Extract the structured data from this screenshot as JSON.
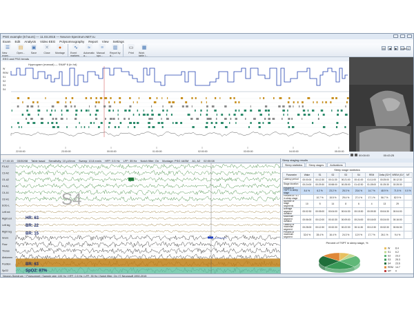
{
  "window": {
    "title": "PSG example (8 hours) — 11.03.2015 — Neuron-Spectrum.NET.ru",
    "menu": [
      "Exam",
      "Edit",
      "Analysis",
      "Video EEG",
      "Polysomnography",
      "Report",
      "View",
      "Settings"
    ]
  },
  "toolbar": {
    "buttons": [
      {
        "label": "New exam...",
        "icon": "new-exam-icon",
        "color": "#3a6fb0"
      },
      {
        "label": "Open...",
        "icon": "open-folder-icon",
        "color": "#e0a43a"
      },
      {
        "label": "Save",
        "icon": "save-icon",
        "color": "#4a78b5"
      },
      {
        "label": "Close",
        "icon": "close-document-icon",
        "color": "#8a9bb0"
      },
      {
        "label": "Montage",
        "icon": "montage-icon",
        "color": "#d66a1f"
      },
      {
        "label": "Event markers",
        "icon": "event-markers-icon",
        "color": "#3a6fb0"
      },
      {
        "label": "Automatic a...",
        "icon": "automatic-analysis-icon",
        "color": "#3a6fb0"
      },
      {
        "label": "Manual spo...",
        "icon": "manual-spo-icon",
        "color": "#7aa0cc"
      },
      {
        "label": "Report by d...",
        "icon": "report-icon",
        "color": "#4a78b5"
      },
      {
        "label": "Print",
        "icon": "print-icon",
        "color": "#555555"
      },
      {
        "label": "Work table i...",
        "icon": "work-table-icon",
        "color": "#3a6fb0"
      }
    ],
    "right_controls": [
      "M",
      "◀",
      "▶",
      "Auto",
      "C"
    ]
  },
  "hypnogram": {
    "header": "EEG and PSG trends",
    "title": "Hypnogram (manual) — SNAP 6 (in hd)",
    "stage_labels": [
      "W",
      "REM",
      "S1",
      "S2",
      "S3",
      "S4"
    ],
    "time_ticks": [
      "22:00:00",
      "23:00:00",
      "00:00:00",
      "01:00:00",
      "02:00:00",
      "03:00:00",
      "04:00:00",
      "05:00:00"
    ]
  },
  "video": {
    "time_start": "00:00:00",
    "time_end": "00:43:25"
  },
  "eeg": {
    "toolbar": [
      "07:40:15",
      "03/30/08",
      "Table basal",
      "Sensitivity: 10 µV/mm",
      "Sweep: 10.8 mm/s",
      "HFF: 0.5 Hz",
      "LFF: 35 Hz",
      "Notch filter: On",
      "Montage: PSG 4ASM",
      "A1, A2",
      "02:00:08"
    ],
    "channels": [
      "F3-A2",
      "C3-A2",
      "O1-A2",
      "F4-A1",
      "C4-A1",
      "O2-A1",
      "EOG-L",
      "Left ext",
      "Right ext",
      "Left leg",
      "Right leg",
      "Snore",
      "Flow",
      "Thorax",
      "Abdomen",
      "Position",
      "SpO2"
    ],
    "stage_overlay": "S4",
    "readouts": {
      "hr": "HR: 63",
      "br1": "BR: 22",
      "br2": "BR: 15",
      "br_bottom": "BR: 63",
      "spo2": "SpO2: 97%"
    },
    "event_label": "Arousal 0.0 s"
  },
  "statusbar": "Neuron-Spectrum + Polysomnet  |  Sample rate: 100 Hz  |  HFF: 0.5 Hz  |  LFF: 35 Hz  |  Notch filter: On  |  © Neurosoft 1992-2015",
  "panel": {
    "title": "Sleep staging results",
    "tabs": [
      "Sleep statistics",
      "Sleep stages",
      "Activations"
    ],
    "active_tab": 1,
    "table_title": "Sleep stage statistics",
    "columns": [
      "Parameter",
      "Wake",
      "S1",
      "S2",
      "S3",
      "S4",
      "REM",
      "Delta (S3+S4)",
      "NREM (S1+S2+S3+S4)",
      "MT"
    ],
    "rows": [
      [
        "Latency period",
        "00:00:00",
        "00:12:30",
        "00:11:30",
        "00:21:00",
        "00:41:00",
        "01:11:00",
        "00:25:00",
        "00:12:30",
        ""
      ],
      [
        "Stage duration",
        "00:24:00",
        "00:29:30",
        "00:58:00",
        "00:28:00",
        "01:42:30",
        "01:28:00",
        "01:25:30",
        "02:28:30",
        ""
      ],
      [
        "Percent of TSPT in sleep stage",
        "8.4 %",
        "6.2 %",
        "23.2 %",
        "25.3 %",
        "23.6 %",
        "14.7 %",
        "48.9 %",
        "71.5 %",
        "0.0 %"
      ],
      [
        "Percent of TST in sleep stage",
        "",
        "10.7 %",
        "15.5 %",
        "29.4 %",
        "27.4 %",
        "17.1 %",
        "56.7 %",
        "82.9 %",
        ""
      ],
      [
        "Number of stage segments",
        "10",
        "5",
        "14",
        "8",
        "6",
        "4",
        "13",
        "29",
        ""
      ],
      [
        "Average segment duration",
        "00:02:30",
        "00:05:00",
        "00:04:00",
        "00:04:30",
        "00:15:30",
        "00:09:30",
        "00:04:30",
        "00:04:00",
        ""
      ],
      [
        "Maximum segment duration",
        "00:06:00",
        "00:12:00",
        "00:10:30",
        "00:09:00",
        "00:24:00",
        "00:16:00",
        "00:24:00",
        "00:16:00",
        ""
      ],
      [
        "Latency of maximum segment",
        "00:28:00",
        "00:12:30",
        "00:32:30",
        "00:22:30",
        "00:11:30",
        "00:12:30",
        "00:32:30",
        "00:06:30",
        ""
      ],
      [
        "Percent of maximum segment",
        "32.6 %",
        "28.4 %",
        "16.4 %",
        "24.3 %",
        "12.9 %",
        "17.7 %",
        "26.1 %",
        "9.4 %",
        ""
      ]
    ],
    "chart_title": "Percent of TSPT in sleep stage, %"
  },
  "chart_data": {
    "type": "pie",
    "title": "Percent of TSPT in sleep stage, %",
    "categories": [
      "W",
      "S1",
      "S2",
      "S3",
      "S4",
      "REM",
      "MT"
    ],
    "values": [
      8.4,
      6.2,
      23.2,
      25.3,
      23.6,
      14.7,
      0.0
    ],
    "colors": [
      "#e8c060",
      "#c0d890",
      "#60b878",
      "#3a9a58",
      "#1f6e3a",
      "#e08838",
      "#c04040"
    ],
    "legend_position": "right"
  }
}
